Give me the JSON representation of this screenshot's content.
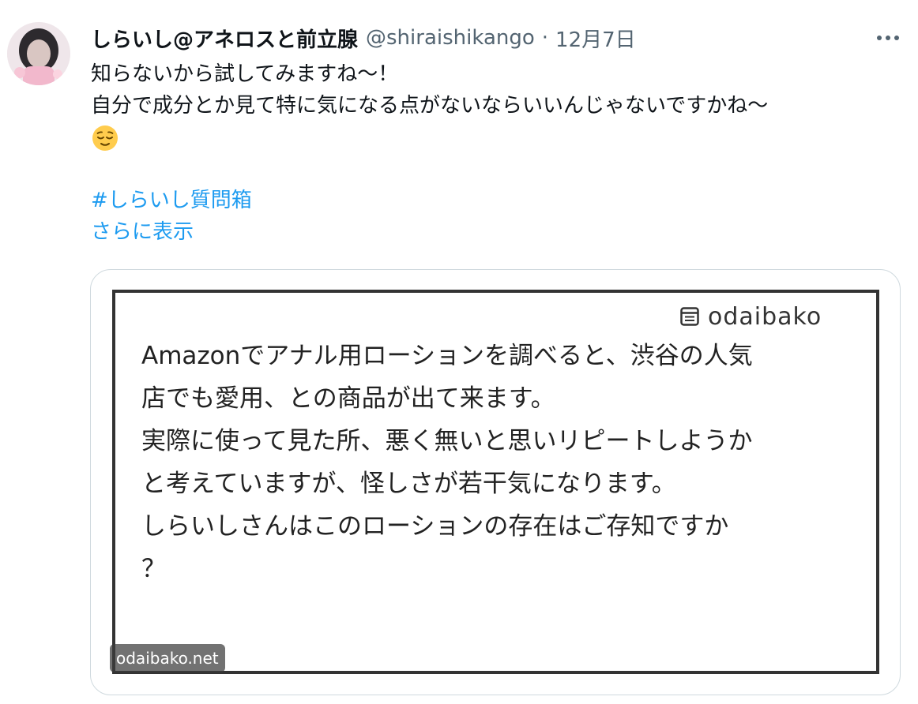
{
  "tweet": {
    "display_name": "しらいし@アネロスと前立腺",
    "handle": "@shiraishikango",
    "separator": "·",
    "date": "12月7日",
    "text_lines": [
      "知らないから試してみますね〜！",
      "自分で成分とか見て特に気になる点がないならいいんじゃないですかね〜"
    ],
    "emoji": "relieved-face",
    "hashtag": "#しらいし質問箱",
    "show_more": "さらに表示"
  },
  "card": {
    "brand": "odaibako",
    "brand_icon": "note-icon",
    "question_lines": [
      "Amazonでアナル用ローションを調べると、渋谷の人気",
      "店でも愛用、との商品が出て来ます。",
      "実際に使って見た所、悪く無いと思いリピートしようか",
      "と考えていますが、怪しさが若干気になります。",
      "しらいしさんはこのローションの存在はご存知ですか",
      "？"
    ],
    "domain": "odaibako.net"
  },
  "colors": {
    "link": "#1d9bf0",
    "secondary_text": "#536471",
    "frame": "#333333",
    "card_border": "#cfd9de"
  }
}
